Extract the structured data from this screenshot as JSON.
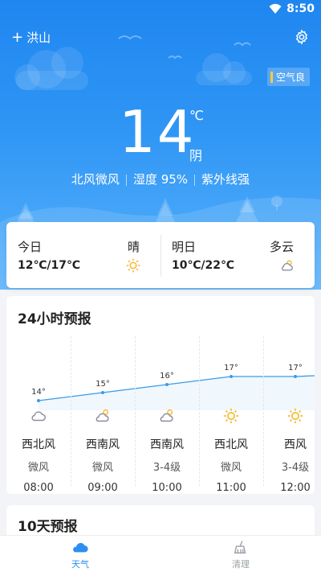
{
  "status": {
    "time": "8:50"
  },
  "header": {
    "city": "洪山",
    "add_symbol": "+"
  },
  "air_quality": {
    "label": "空气良",
    "color": "#ffc940"
  },
  "current": {
    "temperature": "14",
    "unit": "℃",
    "condition": "阴",
    "wind": "北风微风",
    "humidity": "湿度 95%",
    "uv": "紫外线强"
  },
  "daily": [
    {
      "label": "今日",
      "condition": "晴",
      "range": "12℃/17℃",
      "icon": "sun-icon"
    },
    {
      "label": "明日",
      "condition": "多云",
      "range": "10℃/22℃",
      "icon": "partly-cloudy-icon"
    }
  ],
  "hourly": {
    "title": "24小时预报",
    "items": [
      {
        "temp": "14°",
        "icon": "cloud-icon",
        "wind_dir": "西北风",
        "wind_level": "微风",
        "time": "08:00"
      },
      {
        "temp": "15°",
        "icon": "partly-cloudy-icon",
        "wind_dir": "西南风",
        "wind_level": "微风",
        "time": "09:00"
      },
      {
        "temp": "16°",
        "icon": "partly-cloudy-icon",
        "wind_dir": "西南风",
        "wind_level": "3-4级",
        "time": "10:00"
      },
      {
        "temp": "17°",
        "icon": "sun-icon",
        "wind_dir": "西北风",
        "wind_level": "微风",
        "time": "11:00"
      },
      {
        "temp": "17°",
        "icon": "sun-icon",
        "wind_dir": "西风",
        "wind_level": "3-4级",
        "time": "12:00"
      }
    ],
    "temperatures": [
      14,
      15,
      16,
      17,
      17
    ],
    "line_color": "#3a9be8"
  },
  "tenday": {
    "title": "10天预报"
  },
  "tabs": [
    {
      "label": "天气",
      "icon": "weather-cloud-icon",
      "active": true
    },
    {
      "label": "清理",
      "icon": "broom-icon",
      "active": false
    }
  ],
  "colors": {
    "accent": "#2c8ff0",
    "sun": "#f5b82e"
  }
}
